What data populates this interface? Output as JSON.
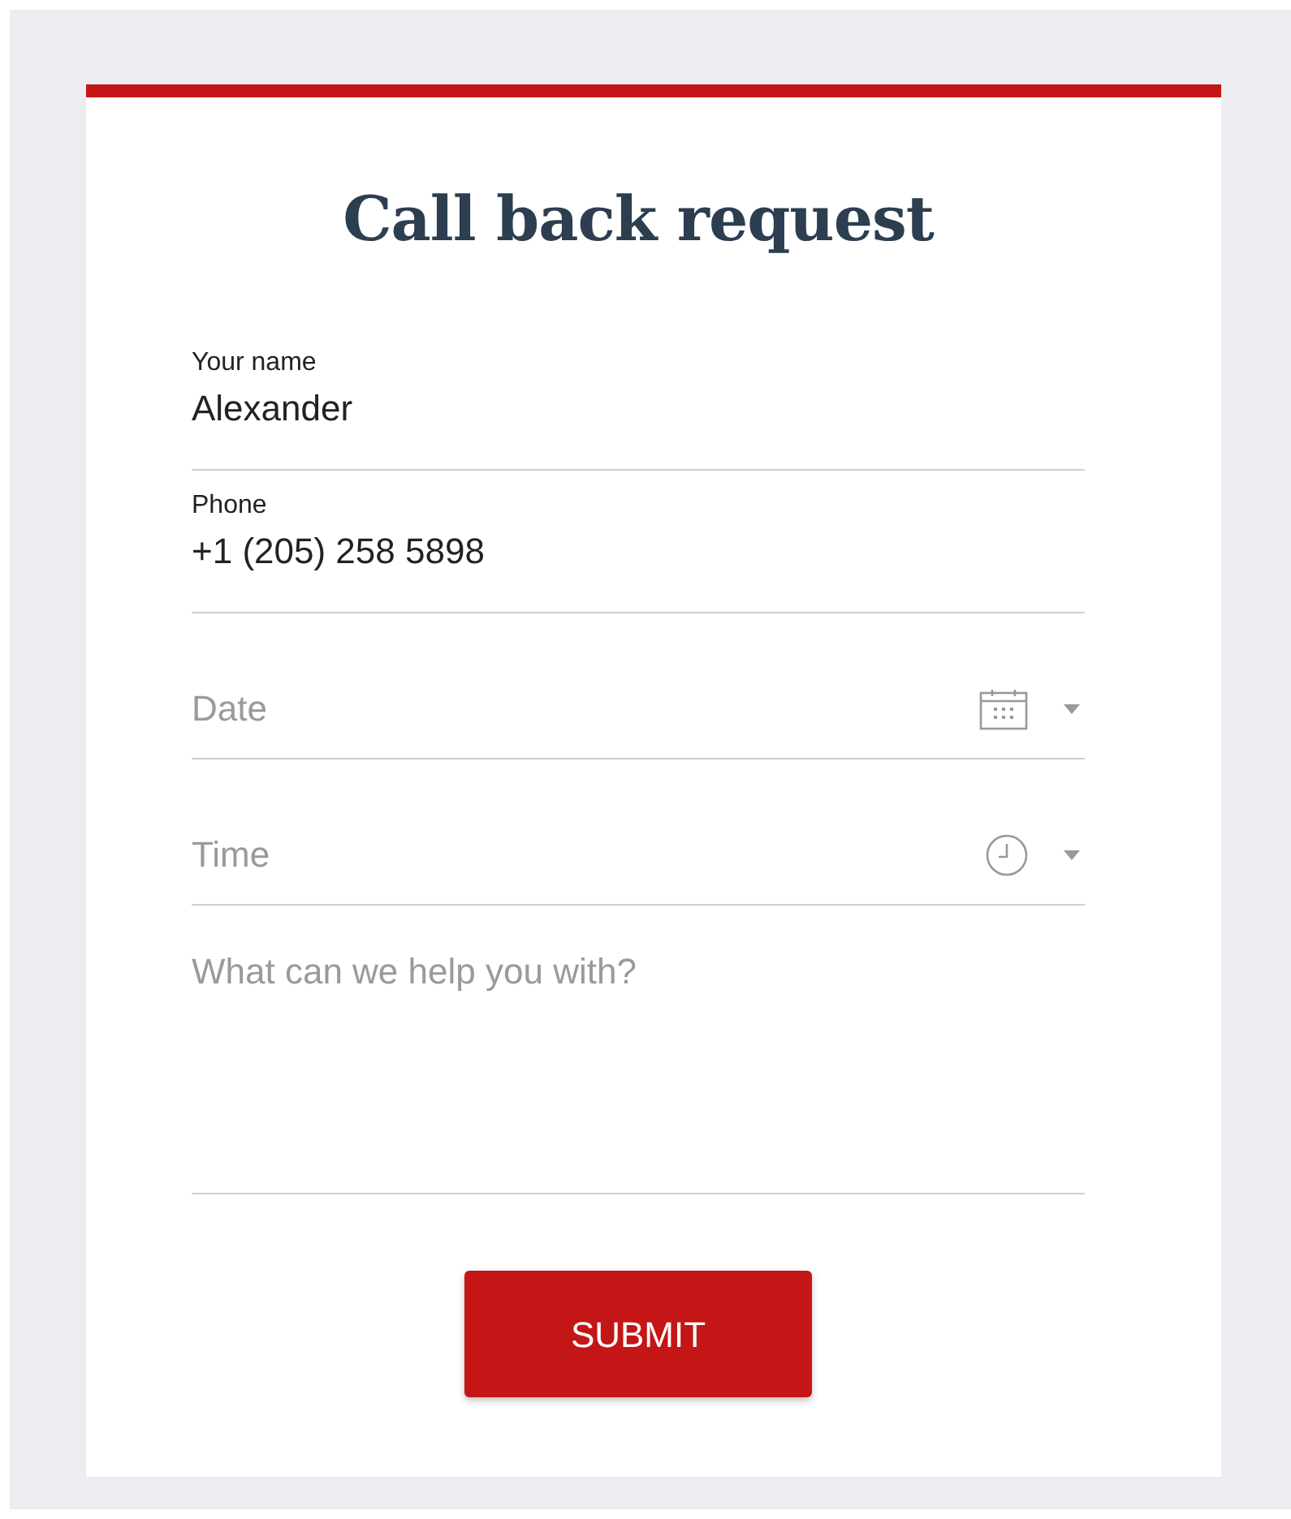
{
  "form": {
    "title": "Call back request",
    "fields": [
      {
        "kind": "text",
        "label": "Your name",
        "value": "Alexander"
      },
      {
        "kind": "text",
        "label": "Phone",
        "value": "+1 (205) 258 5898"
      },
      {
        "kind": "date",
        "placeholder": "Date"
      },
      {
        "kind": "time",
        "placeholder": "Time"
      },
      {
        "kind": "textarea",
        "placeholder": "What can we help you with?"
      }
    ],
    "submit": "SUBMIT"
  }
}
